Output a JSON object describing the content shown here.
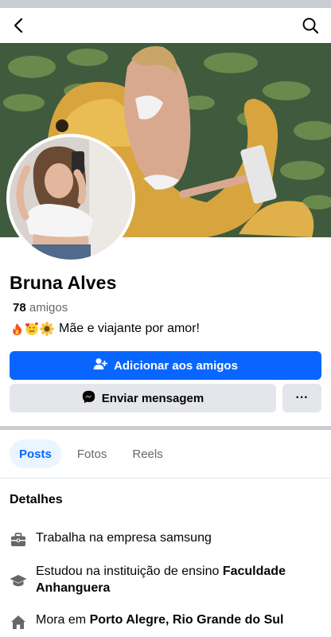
{
  "header": {
    "back_icon": "chevron-left-icon",
    "search_icon": "search-icon"
  },
  "profile": {
    "name": "Bruna Alves",
    "friends_count": "78",
    "friends_label": "amigos",
    "bio_emojis": [
      "fire",
      "smiling-face-with-hearts",
      "sunflower"
    ],
    "bio_text": "Mãe e viajante por amor!"
  },
  "actions": {
    "add_friend_label": "Adicionar aos amigos",
    "message_label": "Enviar mensagem",
    "more_label": "···"
  },
  "tabs": [
    {
      "label": "Posts",
      "active": true
    },
    {
      "label": "Fotos",
      "active": false
    },
    {
      "label": "Reels",
      "active": false
    }
  ],
  "details": {
    "title": "Detalhes",
    "work": {
      "prefix": "Trabalha na empresa samsung",
      "icon": "briefcase-icon"
    },
    "education": {
      "prefix": "Estudou na instituição de ensino ",
      "bold": "Faculdade Anhanguera",
      "icon": "graduation-cap-icon"
    },
    "lives": {
      "prefix": "Mora em ",
      "bold": "Porto Alegre, Rio Grande do Sul",
      "icon": "home-icon"
    }
  },
  "colors": {
    "accent": "#0866ff",
    "secondary_button": "#e4e6eb",
    "muted_text": "#65676b"
  }
}
